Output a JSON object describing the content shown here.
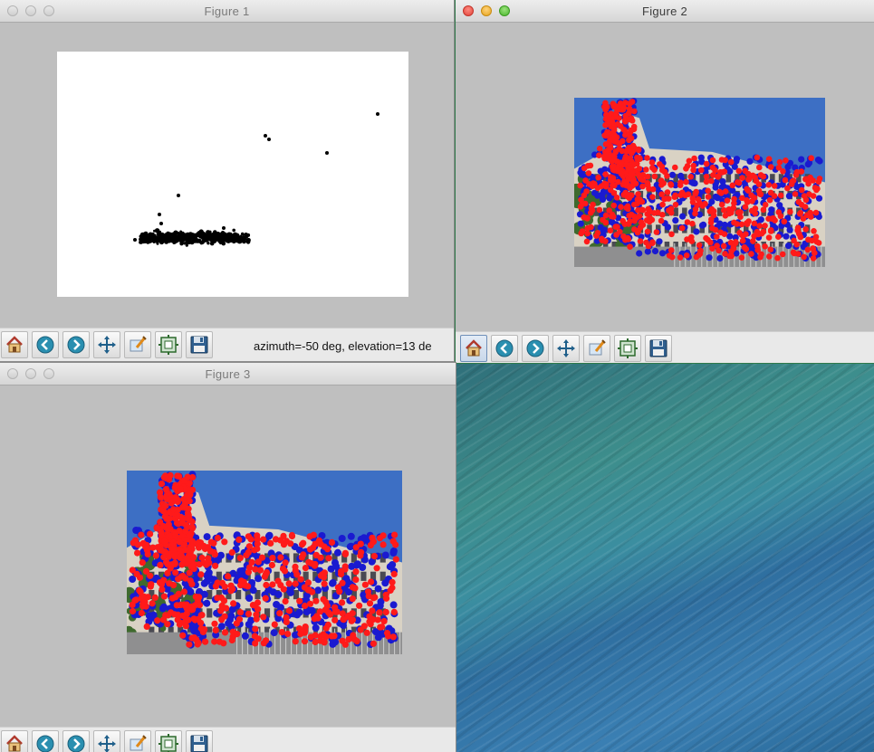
{
  "windows": {
    "figure1": {
      "title": "Figure 1",
      "status_text": "azimuth=-50 deg, elevation=13 de"
    },
    "figure2": {
      "title": "Figure 2"
    },
    "figure3": {
      "title": "Figure 3"
    }
  },
  "toolbar": {
    "buttons": [
      {
        "name": "home-button",
        "icon": "home-icon"
      },
      {
        "name": "back-button",
        "icon": "back-arrow-icon"
      },
      {
        "name": "forward-button",
        "icon": "forward-arrow-icon"
      },
      {
        "name": "pan-button",
        "icon": "pan-cross-arrows-icon"
      },
      {
        "name": "zoom-button",
        "icon": "zoom-rect-icon"
      },
      {
        "name": "subplots-button",
        "icon": "subplots-config-icon"
      },
      {
        "name": "save-button",
        "icon": "floppy-disk-icon"
      }
    ]
  },
  "colors": {
    "window_bg": "#bfbfbf",
    "marker_red": "#ff1a1a",
    "marker_blue": "#1a1ad0",
    "scatter_black": "#000000",
    "sky": "#3d6fc4"
  }
}
